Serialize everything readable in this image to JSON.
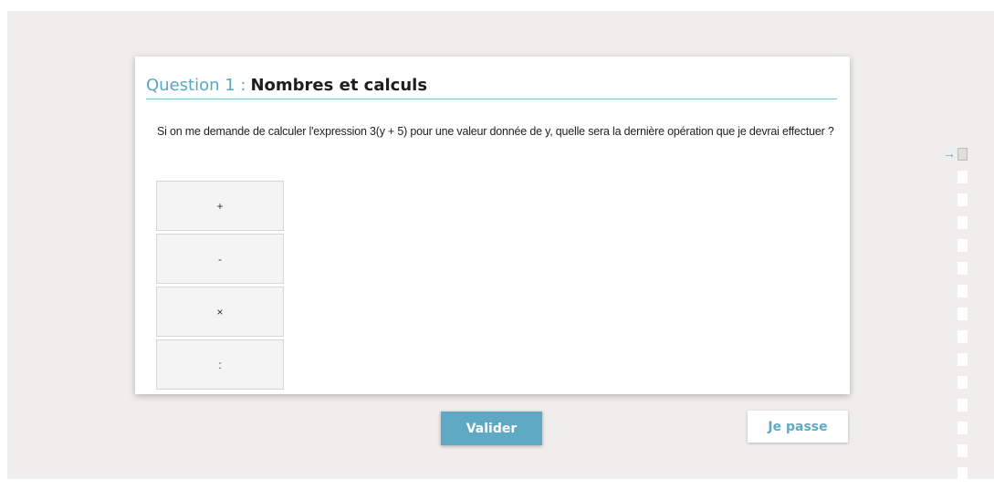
{
  "question": {
    "label": "Question 1 :",
    "title": "Nombres et calculs",
    "text": "Si on me demande de calculer l'expression 3(y + 5) pour une valeur donnée de y, quelle sera la dernière opération que je devrai effectuer ?"
  },
  "answers": [
    {
      "label": "+"
    },
    {
      "label": "-"
    },
    {
      "label": "×"
    },
    {
      "label": ":"
    }
  ],
  "buttons": {
    "validate": "Valider",
    "skip": "Je passe"
  },
  "progress": {
    "current_index": 1,
    "total_visible": 15,
    "arrow_glyph": "→"
  },
  "colors": {
    "accent": "#5fa9c4",
    "background": "#efeeec"
  }
}
